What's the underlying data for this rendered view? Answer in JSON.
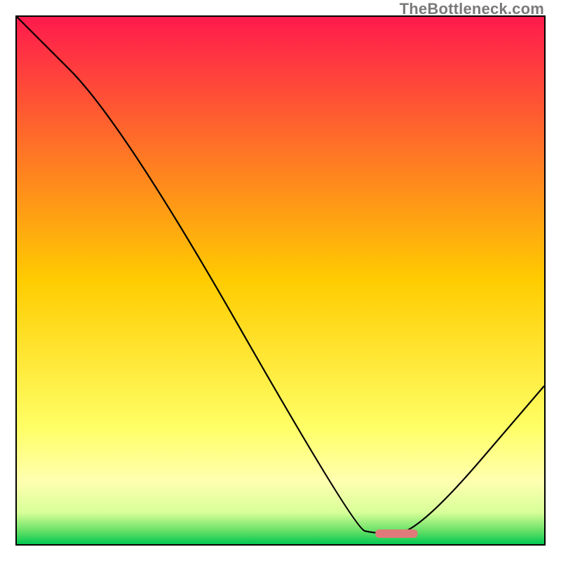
{
  "watermark": "TheBottleneck.com",
  "chart_data": {
    "type": "line",
    "title": "",
    "xlabel": "",
    "ylabel": "",
    "xlim": [
      0,
      100
    ],
    "ylim": [
      0,
      100
    ],
    "x": [
      0,
      20,
      64,
      68,
      76,
      100
    ],
    "values": [
      100,
      80,
      3,
      2,
      2,
      30
    ],
    "marker": {
      "x_range": [
        68,
        76
      ],
      "y": 2,
      "color": "#e07a7a"
    },
    "gradient_stops": [
      {
        "offset": 0.0,
        "color": "#ff1a4d"
      },
      {
        "offset": 0.5,
        "color": "#ffcc00"
      },
      {
        "offset": 0.78,
        "color": "#ffff66"
      },
      {
        "offset": 0.88,
        "color": "#ffffb0"
      },
      {
        "offset": 0.94,
        "color": "#d8ff99"
      },
      {
        "offset": 0.975,
        "color": "#66e066"
      },
      {
        "offset": 1.0,
        "color": "#00c853"
      }
    ]
  }
}
